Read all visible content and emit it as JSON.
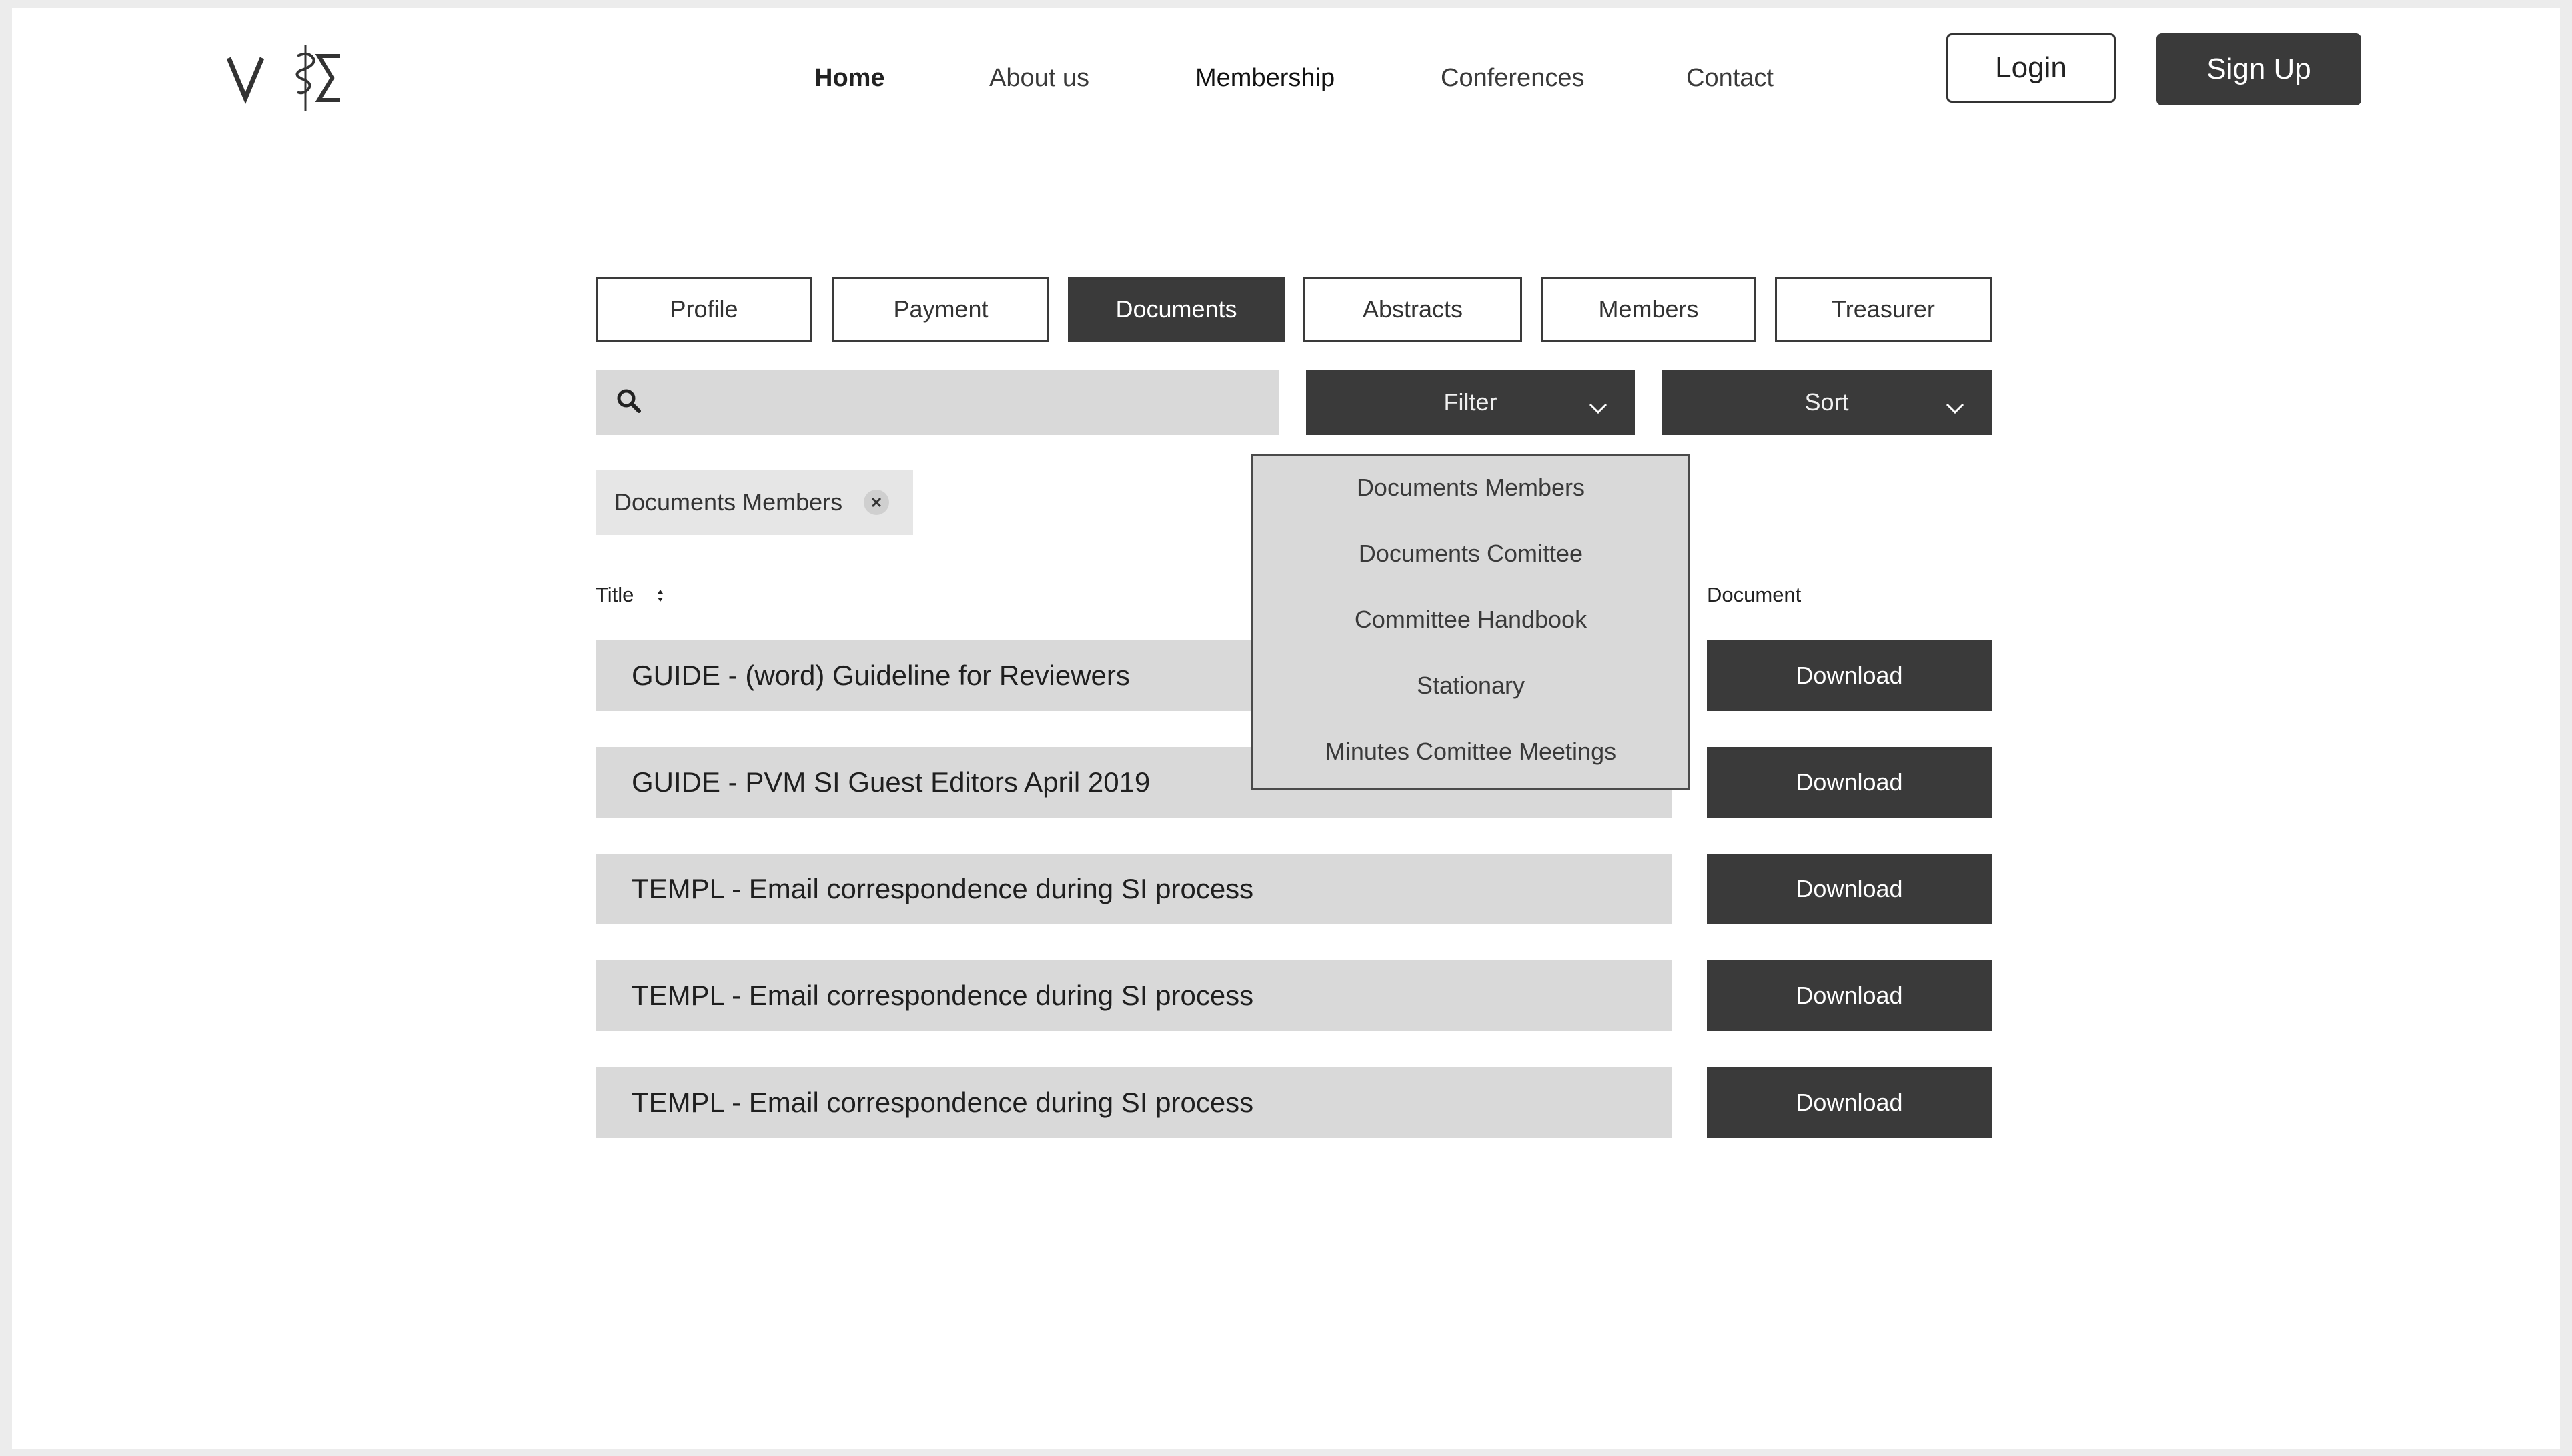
{
  "header": {
    "logo_alt": "VΣ",
    "nav": [
      "Home",
      "About us",
      "Membership",
      "Conferences",
      "Contact"
    ],
    "login_label": "Login",
    "signup_label": "Sign Up"
  },
  "tabs": [
    "Profile",
    "Payment",
    "Documents",
    "Abstracts",
    "Members",
    "Treasurer"
  ],
  "active_tab": "Documents",
  "search": {
    "placeholder": ""
  },
  "filter_label": "Filter",
  "sort_label": "Sort",
  "active_filter_chip": "Documents Members",
  "filter_menu": [
    "Documents Members",
    "Documents Comittee",
    "Committee Handbook",
    "Stationary",
    "Minutes Comittee Meetings"
  ],
  "table": {
    "headers": {
      "title": "Title",
      "document": "Document"
    },
    "rows": [
      {
        "title": "GUIDE - (word) Guideline for Reviewers",
        "action": "Download"
      },
      {
        "title": "GUIDE - PVM SI Guest Editors April 2019",
        "action": "Download"
      },
      {
        "title": "TEMPL - Email correspondence during SI process",
        "action": "Download"
      },
      {
        "title": "TEMPL - Email correspondence during SI process",
        "action": "Download"
      },
      {
        "title": "TEMPL - Email correspondence during SI process",
        "action": "Download"
      }
    ]
  },
  "colors": {
    "dark": "#3a3a3a",
    "light_gray": "#d9d9d9",
    "white": "#ffffff"
  },
  "icons": [
    "logo-icon",
    "search-icon",
    "chevron-down-icon",
    "sort-icon",
    "close-icon"
  ]
}
